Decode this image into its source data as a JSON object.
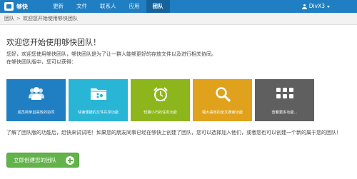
{
  "app": {
    "name": "够快"
  },
  "nav": {
    "items": [
      "更新",
      "文件",
      "联系人",
      "应用",
      "团队"
    ],
    "active": "团队"
  },
  "user": {
    "name": "DivX3"
  },
  "breadcrumb": {
    "root": "团队",
    "separator": ">",
    "current": "欢迎您开始使用够快团队"
  },
  "main": {
    "title": "欢迎您开始使用够快团队！",
    "intro_line1": "您好，欢迎您使用够快团队，够快团队是为了让一群人能够更好的存放文件以及进行相关协同。",
    "intro_line2": "在够快团队版中，您可以获得："
  },
  "tiles": [
    {
      "label": "成员简单且高效的协同",
      "color": "#1f7fc2",
      "icon": "team-icon"
    },
    {
      "label": "快速便捷的文件共享功能",
      "color": "#29b6d6",
      "icon": "folder-icon"
    },
    {
      "label": "轻量小巧的任务功能",
      "color": "#8cb61b",
      "icon": "alarm-clock-icon"
    },
    {
      "label": "强大高效的全文搜索功能",
      "color": "#e0a21c",
      "icon": "search-icon"
    },
    {
      "label": "查看更多功能...",
      "color": "#5f5f5f",
      "icon": "more-grid-icon"
    }
  ],
  "cta": {
    "text": "了解了团队版的功能后，赶快来试试吧！如果您的朋友同事已经在够快上创建了团队，您可以选择加入他们，或者您也可以创建一个新的属于您的团队！",
    "button_label": "立即创建您的团队"
  },
  "colors": {
    "topbar": "#1f7fc2",
    "button": "#62b34a"
  }
}
